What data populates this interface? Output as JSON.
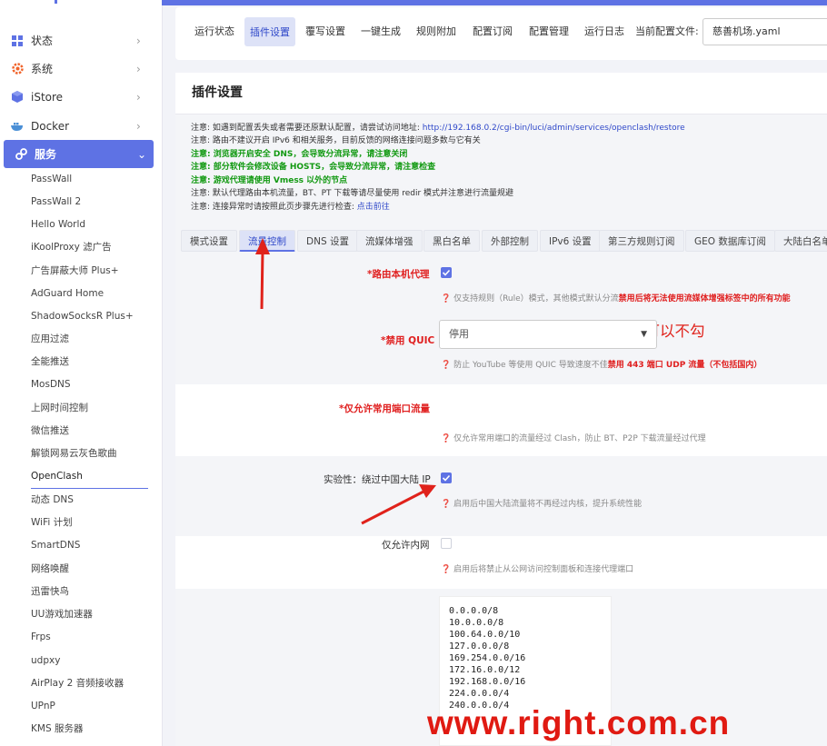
{
  "sidebar": {
    "main": [
      {
        "label": "状态",
        "icon": "dashboard-icon"
      },
      {
        "label": "系统",
        "icon": "gear-icon"
      },
      {
        "label": "iStore",
        "icon": "cube-icon"
      },
      {
        "label": "Docker",
        "icon": "docker-icon"
      },
      {
        "label": "服务",
        "icon": "link-icon"
      }
    ],
    "sub": [
      "PassWall",
      "PassWall 2",
      "Hello World",
      "iKoolProxy 滤广告",
      "广告屏蔽大师 Plus+",
      "AdGuard Home",
      "ShadowSocksR Plus+",
      "应用过滤",
      "全能推送",
      "MosDNS",
      "上网时间控制",
      "微信推送",
      "解锁网易云灰色歌曲",
      "OpenClash",
      "动态 DNS",
      "WiFi 计划",
      "SmartDNS",
      "网络唤醒",
      "迅雷快鸟",
      "UU游戏加速器",
      "Frps",
      "udpxy",
      "AirPlay 2 音频接收器",
      "UPnP",
      "KMS 服务器"
    ]
  },
  "topnav": {
    "items": [
      "运行状态",
      "插件设置",
      "覆写设置",
      "一键生成",
      "规则附加",
      "配置订阅",
      "配置管理",
      "运行日志"
    ],
    "config_label": "当前配置文件:",
    "config_value": "慈善机场.yaml"
  },
  "panel": {
    "title": "插件设置",
    "notes": [
      {
        "text": "注意: 如遇到配置丢失或者需要还原默认配置，请尝试访问地址: ",
        "link": "http://192.168.0.2/cgi-bin/luci/admin/services/openclash/restore"
      },
      {
        "text": "注意: 路由不建议开启 IPv6 和相关服务，目前反馈的网络连接问题多数与它有关",
        "link": ""
      },
      {
        "text": "注意: 浏览器开启安全 DNS，会导致分流异常，请注意关闭",
        "link": ""
      },
      {
        "text": "注意: 部分软件会修改设备 HOSTS，会导致分流异常，请注意检查",
        "link": ""
      },
      {
        "text": "注意: 游戏代理请使用 Vmess 以外的节点",
        "link": ""
      },
      {
        "text": "注意: 默认代理路由本机流量，BT、PT 下载等请尽量使用 redir 模式并注意进行流量规避",
        "link": ""
      },
      {
        "text": "注意: 连接异常时请按照此页步骤先进行检查: ",
        "link": "点击前往"
      }
    ],
    "tabs": [
      "模式设置",
      "流量控制",
      "DNS 设置",
      "流媒体增强",
      "黑白名单",
      "外部控制",
      "IPv6 设置",
      "第三方规则订阅",
      "GEO 数据库订阅",
      "大陆白名单"
    ]
  },
  "fields": {
    "route_local": {
      "label": "*路由本机代理",
      "checked": true,
      "help": "仅支持规则（Rule）模式，其他模式默认分流",
      "help_warn": "禁用后将无法使用流媒体增强标签中的所有功能"
    },
    "disable_quic": {
      "label": "*禁用 QUIC",
      "checked": false,
      "help": "防止 YouTube 等使用 QUIC 导致速度不佳",
      "help_warn": "禁用 443 端口 UDP 流量（不包括国内）"
    },
    "common_ports": {
      "label": "*仅允许常用端口流量",
      "value": "停用",
      "help": "仅允许常用端口的流量经过 Clash，防止 BT、P2P 下载流量经过代理"
    },
    "bypass_cn": {
      "label": "实验性：绕过中国大陆 IP",
      "checked": true,
      "help": "启用后中国大陆流量将不再经过内核，提升系统性能"
    },
    "lan_only": {
      "label": "仅允许内网",
      "checked": false,
      "help": "启用后将禁止从公网访问控制面板和连接代理端口"
    },
    "ip_list": [
      "0.0.0.0/8",
      "10.0.0.0/8",
      "100.64.0.0/10",
      "127.0.0.0/8",
      "169.254.0.0/16",
      "172.16.0.0/12",
      "192.168.0.0/16",
      "224.0.0.0/4",
      "240.0.0.0/4"
    ]
  },
  "annotation": "网速可以的话，建议这个可以不勾",
  "watermark": "www.right.com.cn",
  "colors": {
    "accent": "#5e72e4",
    "warn": "#e02020",
    "green": "#119911"
  }
}
